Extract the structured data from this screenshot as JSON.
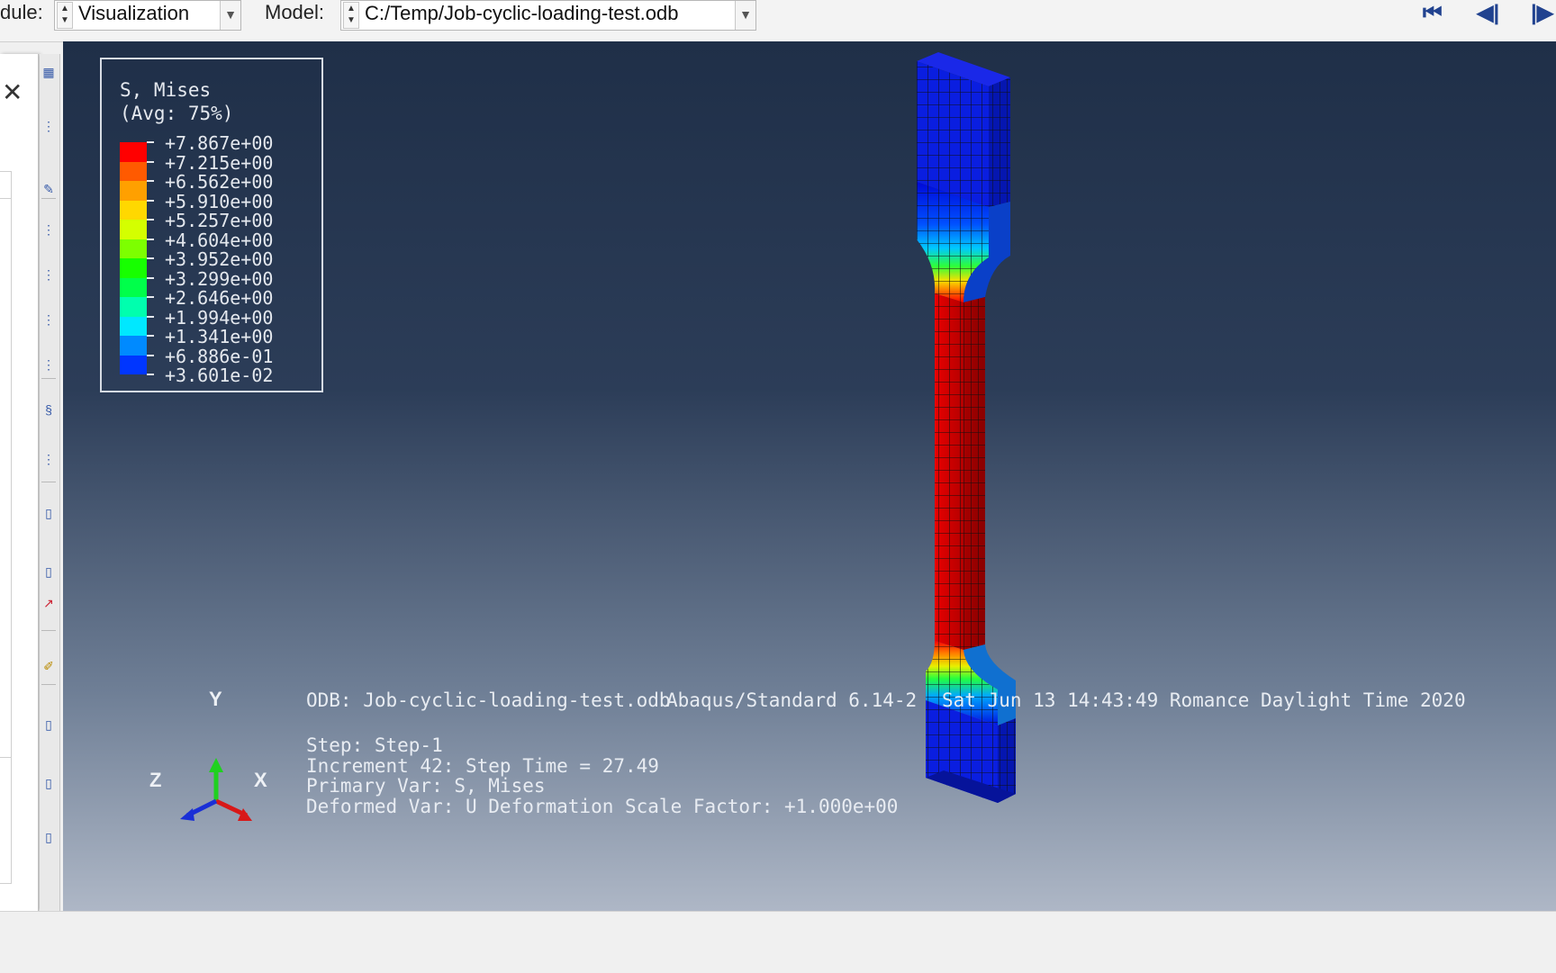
{
  "toolbar": {
    "module_label": "dule:",
    "module_value": "Visualization",
    "model_label": "Model:",
    "model_value": "C:/Temp/Job-cyclic-loading-test.odb",
    "nav_first": "⏮",
    "nav_prev": "◀|",
    "nav_next": "|▶"
  },
  "panel": {
    "close_glyph": "✕"
  },
  "legend": {
    "title": "S, Mises",
    "subtitle": "(Avg: 75%)",
    "values": [
      "+7.867e+00",
      "+7.215e+00",
      "+6.562e+00",
      "+5.910e+00",
      "+5.257e+00",
      "+4.604e+00",
      "+3.952e+00",
      "+3.299e+00",
      "+2.646e+00",
      "+1.994e+00",
      "+1.341e+00",
      "+6.886e-01",
      "+3.601e-02"
    ],
    "colors": [
      "#ff0000",
      "#ff5a00",
      "#ffa000",
      "#ffd800",
      "#d4ff00",
      "#7dff00",
      "#17ff00",
      "#00ff4a",
      "#00ffae",
      "#00e8ff",
      "#008aff",
      "#0036ff",
      "#0000ff"
    ]
  },
  "info": {
    "odb": "ODB: Job-cyclic-loading-test.odb",
    "solver": "Abaqus/Standard 6.14-2",
    "date": "Sat Jun 13 14:43:49 Romance Daylight Time 2020",
    "step": "Step: Step-1",
    "increment": "Increment     42: Step Time =    27.49",
    "primary_var": "Primary Var: S, Mises",
    "deformed_var": "Deformed Var: U   Deformation Scale Factor: +1.000e+00"
  },
  "triad": {
    "x": "X",
    "y": "Y",
    "z": "Z"
  }
}
